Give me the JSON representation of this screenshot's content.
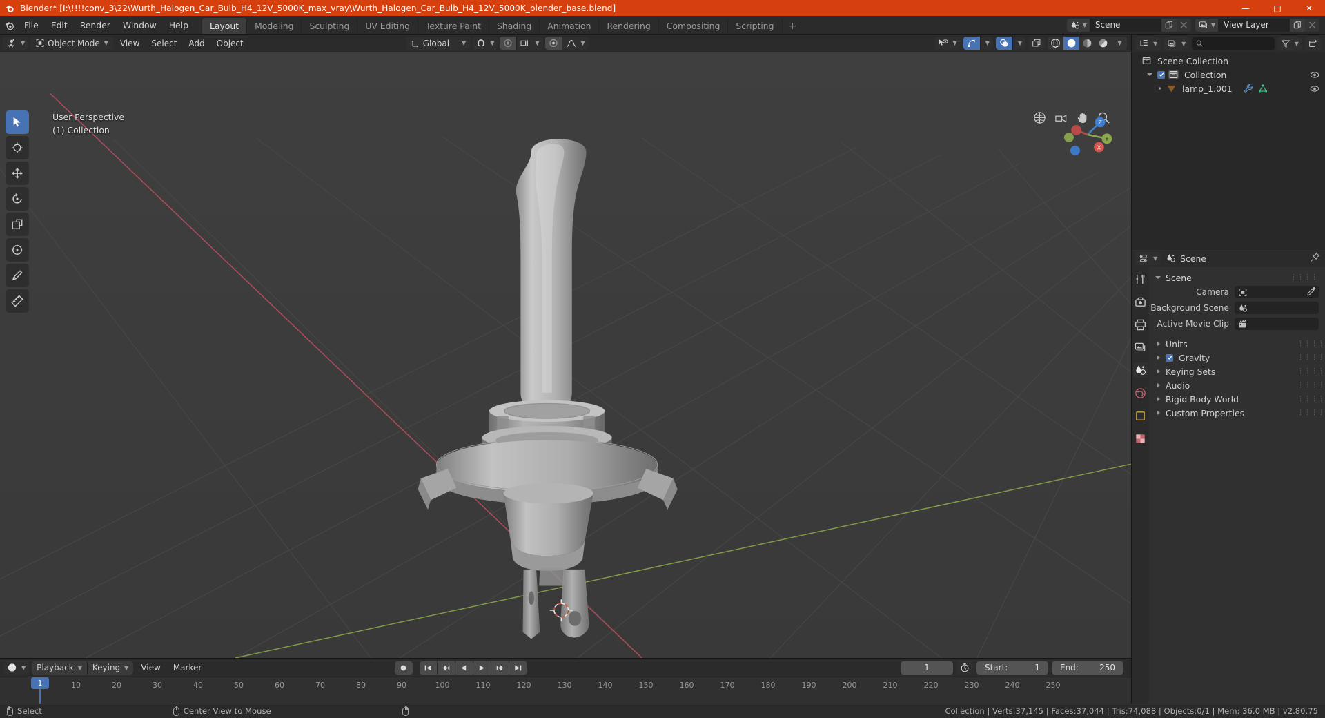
{
  "window": {
    "title": "Blender* [I:\\!!!!conv_3\\22\\Wurth_Halogen_Car_Bulb_H4_12V_5000K_max_vray\\Wurth_Halogen_Car_Bulb_H4_12V_5000K_blender_base.blend]",
    "minimize": "—",
    "maximize": "□",
    "close": "✕"
  },
  "topbar": {
    "menus": [
      "File",
      "Edit",
      "Render",
      "Window",
      "Help"
    ],
    "workspaces": [
      {
        "label": "Layout",
        "active": true
      },
      {
        "label": "Modeling",
        "active": false
      },
      {
        "label": "Sculpting",
        "active": false
      },
      {
        "label": "UV Editing",
        "active": false
      },
      {
        "label": "Texture Paint",
        "active": false
      },
      {
        "label": "Shading",
        "active": false
      },
      {
        "label": "Animation",
        "active": false
      },
      {
        "label": "Rendering",
        "active": false
      },
      {
        "label": "Compositing",
        "active": false
      },
      {
        "label": "Scripting",
        "active": false
      }
    ],
    "add_workspace": "+",
    "scene_name": "Scene",
    "view_layer_name": "View Layer"
  },
  "viewport_header": {
    "editor_type": "editor-type-3d-viewport",
    "mode": "Object Mode",
    "menus": [
      "View",
      "Select",
      "Add",
      "Object"
    ],
    "transform_orientation": "Global",
    "snap_label": "snapping",
    "proportional_label": "proportional-editing"
  },
  "viewport": {
    "perspective": "User Perspective",
    "collection_info": "(1) Collection",
    "axis_labels": {
      "x": "X",
      "y": "Y",
      "z": "Z"
    },
    "tools": [
      "tweak-select-tool",
      "cursor-tool",
      "move-tool",
      "rotate-tool",
      "scale-tool",
      "transform-tool",
      "annotate-tool",
      "measure-tool"
    ]
  },
  "outliner": {
    "display_mode": "View Layer",
    "search_placeholder": "",
    "rows": [
      {
        "label": "Scene Collection",
        "indent": 0,
        "icon": "collection-icon",
        "has_eye": false,
        "has_checkbox": false,
        "expander": "none"
      },
      {
        "label": "Collection",
        "indent": 1,
        "icon": "collection-icon",
        "has_eye": true,
        "has_checkbox": true,
        "expander": "down"
      },
      {
        "label": "lamp_1.001",
        "indent": 2,
        "icon": "mesh-object-icon",
        "has_eye": true,
        "has_checkbox": false,
        "expander": "right"
      }
    ]
  },
  "properties": {
    "breadcrumb": "Scene",
    "panel_title": "Scene",
    "fields": [
      {
        "label": "Camera",
        "icon": "camera-icon",
        "value": "",
        "eyedropper": true
      },
      {
        "label": "Background Scene",
        "icon": "scene-icon",
        "value": "",
        "eyedropper": false
      },
      {
        "label": "Active Movie Clip",
        "icon": "movie-clip-icon",
        "value": "",
        "eyedropper": false
      }
    ],
    "sections": [
      {
        "label": "Units",
        "checkbox": false
      },
      {
        "label": "Gravity",
        "checkbox": true
      },
      {
        "label": "Keying Sets",
        "checkbox": false
      },
      {
        "label": "Audio",
        "checkbox": false
      },
      {
        "label": "Rigid Body World",
        "checkbox": false
      },
      {
        "label": "Custom Properties",
        "checkbox": false
      }
    ],
    "tabs": [
      "tool-icon",
      "render-icon",
      "output-icon",
      "view-layer-icon",
      "scene-icon",
      "world-icon",
      "object-icon",
      "texture-icon"
    ]
  },
  "timeline": {
    "menus": [
      "Playback",
      "Keying",
      "View",
      "Marker"
    ],
    "current_frame": "1",
    "start_label": "Start:",
    "start_value": "1",
    "end_label": "End:",
    "end_value": "250",
    "ticks": [
      "10",
      "20",
      "30",
      "40",
      "50",
      "60",
      "70",
      "80",
      "90",
      "100",
      "110",
      "120",
      "130",
      "140",
      "150",
      "160",
      "170",
      "180",
      "190",
      "200",
      "210",
      "220",
      "230",
      "240",
      "250"
    ],
    "playhead_frame": "1"
  },
  "statusbar": {
    "left_items": [
      {
        "mouse": "left",
        "label": "Select"
      },
      {
        "mouse": "middle",
        "label": "Center View to Mouse"
      },
      {
        "mouse": "right",
        "label": ""
      }
    ],
    "stats": "Collection | Verts:37,145 | Faces:37,044 | Tris:74,088 | Objects:0/1 | Mem: 36.0 MB | v2.80.75"
  },
  "colors": {
    "title_bar": "#d6400f",
    "accent_blue": "#4772b3",
    "header_bg": "#2b2b2b",
    "viewport_bg": "#3b3b3b",
    "x_axis": "#c14f5e",
    "y_axis": "#8ba64a",
    "z_axis": "#2e76c9"
  }
}
